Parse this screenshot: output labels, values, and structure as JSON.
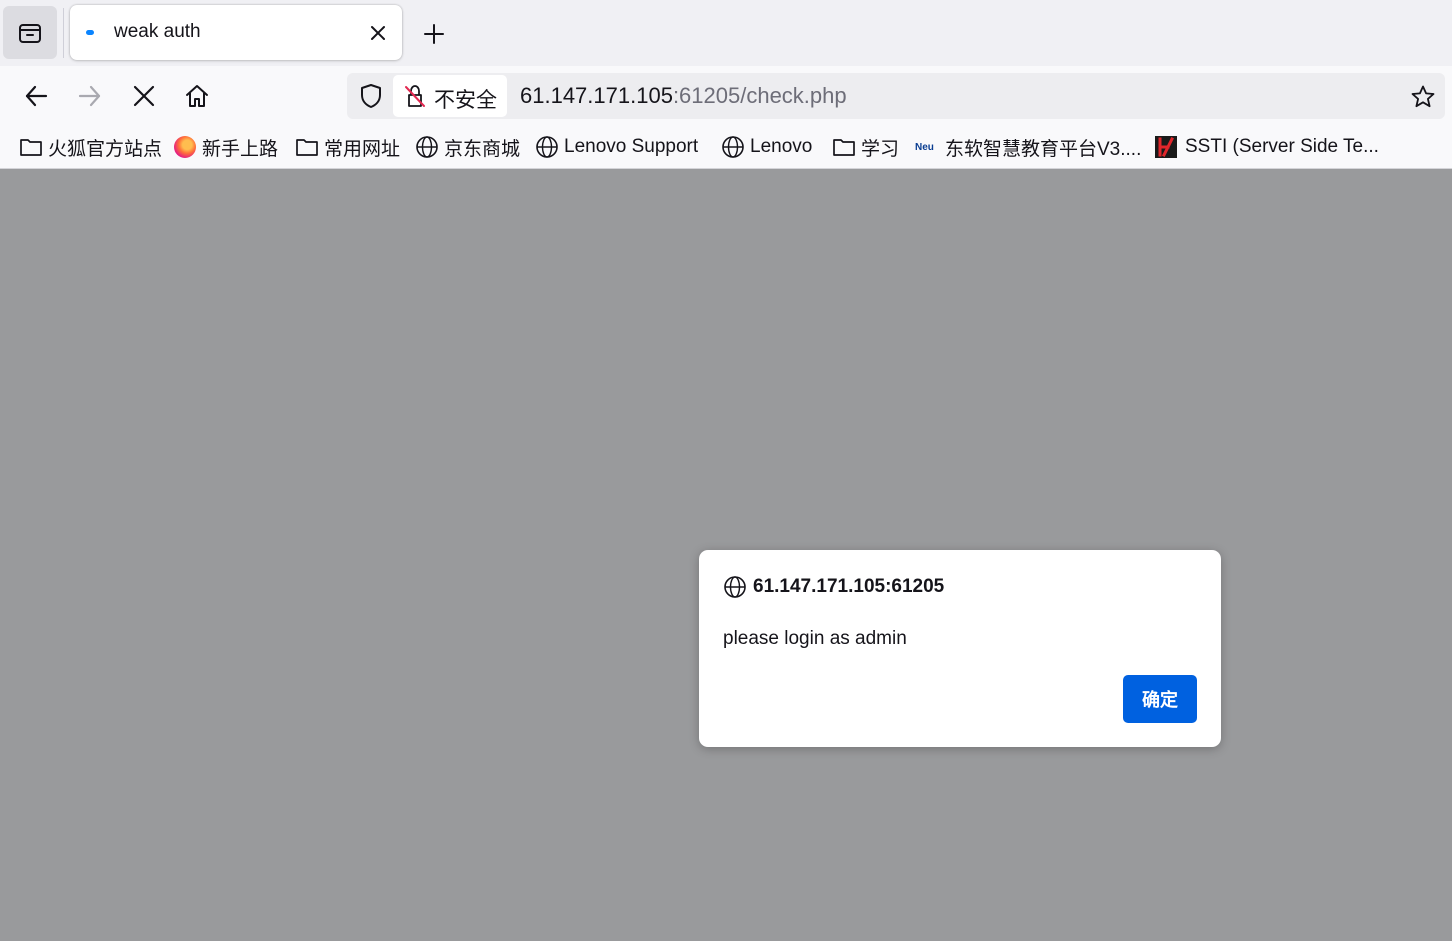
{
  "tab": {
    "title": "weak auth"
  },
  "urlbar": {
    "security_label": "不安全",
    "url_host": "61.147.171.105",
    "url_rest": ":61205/check.php"
  },
  "bookmarks": [
    {
      "label": "火狐官方站点",
      "icon": "folder-icon"
    },
    {
      "label": "新手上路",
      "icon": "firefox-icon"
    },
    {
      "label": "常用网址",
      "icon": "folder-icon"
    },
    {
      "label": "京东商城",
      "icon": "globe-icon"
    },
    {
      "label": "Lenovo Support",
      "icon": "globe-icon"
    },
    {
      "label": "Lenovo",
      "icon": "globe-icon"
    },
    {
      "label": "学习",
      "icon": "folder-icon"
    },
    {
      "label": "东软智慧教育平台V3....",
      "icon": "neu-icon"
    },
    {
      "label": "SSTI (Server Side Te...",
      "icon": "ssti-icon"
    }
  ],
  "dialog": {
    "origin": "61.147.171.105:61205",
    "message": "please login as admin",
    "ok_label": "确定"
  },
  "colors": {
    "accent": "#0061e0",
    "page_overlay": "#999a9c",
    "throbber": "#0a84ff"
  }
}
